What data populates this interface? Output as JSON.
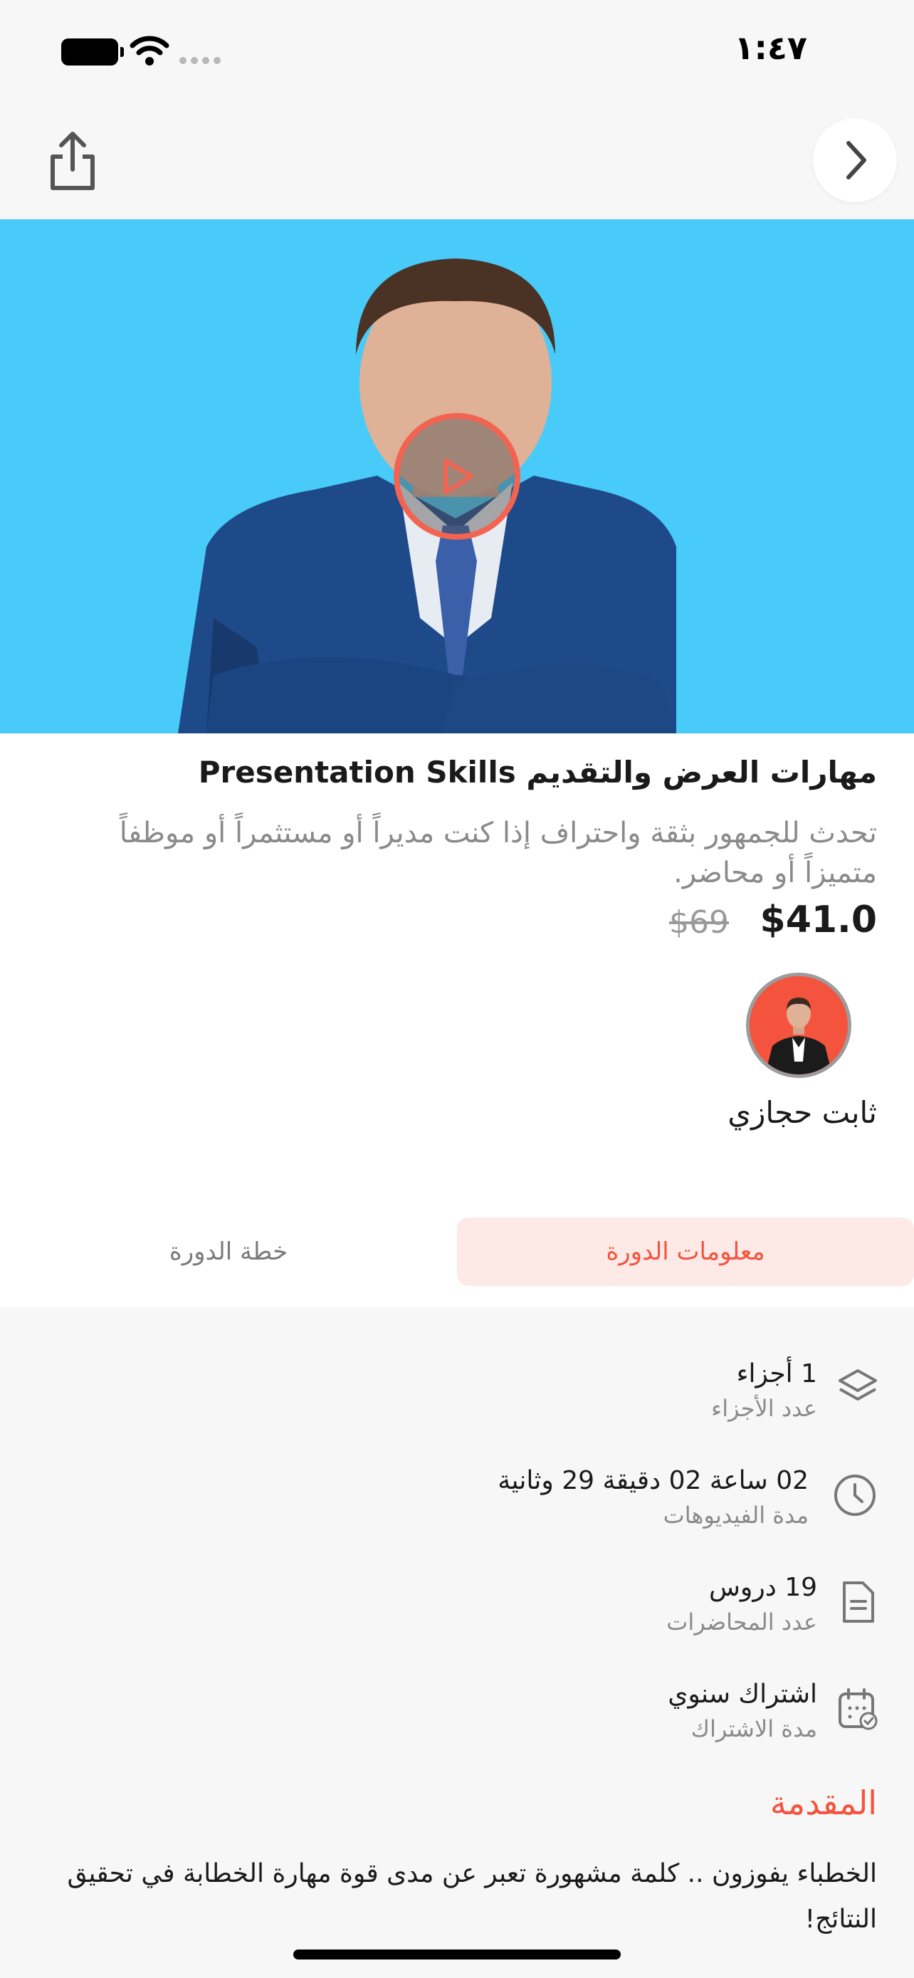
{
  "status_bar": {
    "time": "١:٤٧"
  },
  "course": {
    "title": "مهارات العرض والتقديم Presentation Skills",
    "description": "تحدث للجمهور بثقة واحتراف إذا كنت مديراً أو مستثمراً أو موظفاً متميزاً أو محاضر.",
    "price": "$41.0",
    "old_price": "$69"
  },
  "instructor": {
    "name": "ثابت حجازي"
  },
  "tabs": {
    "info": "معلومات الدورة",
    "plan": "خطة الدورة"
  },
  "details": [
    {
      "icon": "layers-icon",
      "value": "1 أجزاء",
      "label": "عدد الأجزاء"
    },
    {
      "icon": "clock-icon",
      "value": "02 ساعة 02 دقيقة 29 وثانية",
      "label": "مدة الفيديوهات"
    },
    {
      "icon": "document-icon",
      "value": "19 دروس",
      "label": "عدد المحاضرات"
    },
    {
      "icon": "calendar-icon",
      "value": "اشتراك سنوي",
      "label": "مدة الاشتراك"
    }
  ],
  "intro": {
    "heading": "المقدمة",
    "text": "الخطباء يفوزون .. كلمة مشهورة تعبر عن مدى قوة مهارة الخطابة في تحقيق النتائج!"
  },
  "colors": {
    "accent": "#f4533d",
    "hero_bg": "#48cbf8",
    "tab_active_bg": "#fde9e6"
  }
}
